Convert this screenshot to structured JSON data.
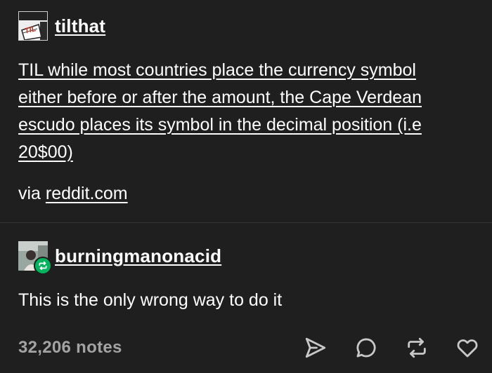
{
  "original_post": {
    "username": "tilthat",
    "avatar_label": "TIL",
    "title_lines": [
      "TIL while most countries place the currency symbol",
      "either before or after the amount, the Cape Verdean",
      "escudo places its symbol in the decimal position (i.e",
      "20$00)"
    ],
    "via_prefix": "via ",
    "via_link": "reddit.com"
  },
  "reblog": {
    "username": "burningmanonacid",
    "comment": "This is the only wrong way to do it"
  },
  "footer": {
    "notes": "32,206 notes"
  },
  "colors": {
    "background": "#1f1f1f",
    "text": "#ffffff",
    "muted": "#a3a3a3",
    "divider": "#363636",
    "reblog_badge": "#00b35c"
  },
  "icons": [
    "share-icon",
    "reply-icon",
    "reblog-icon",
    "like-icon"
  ]
}
